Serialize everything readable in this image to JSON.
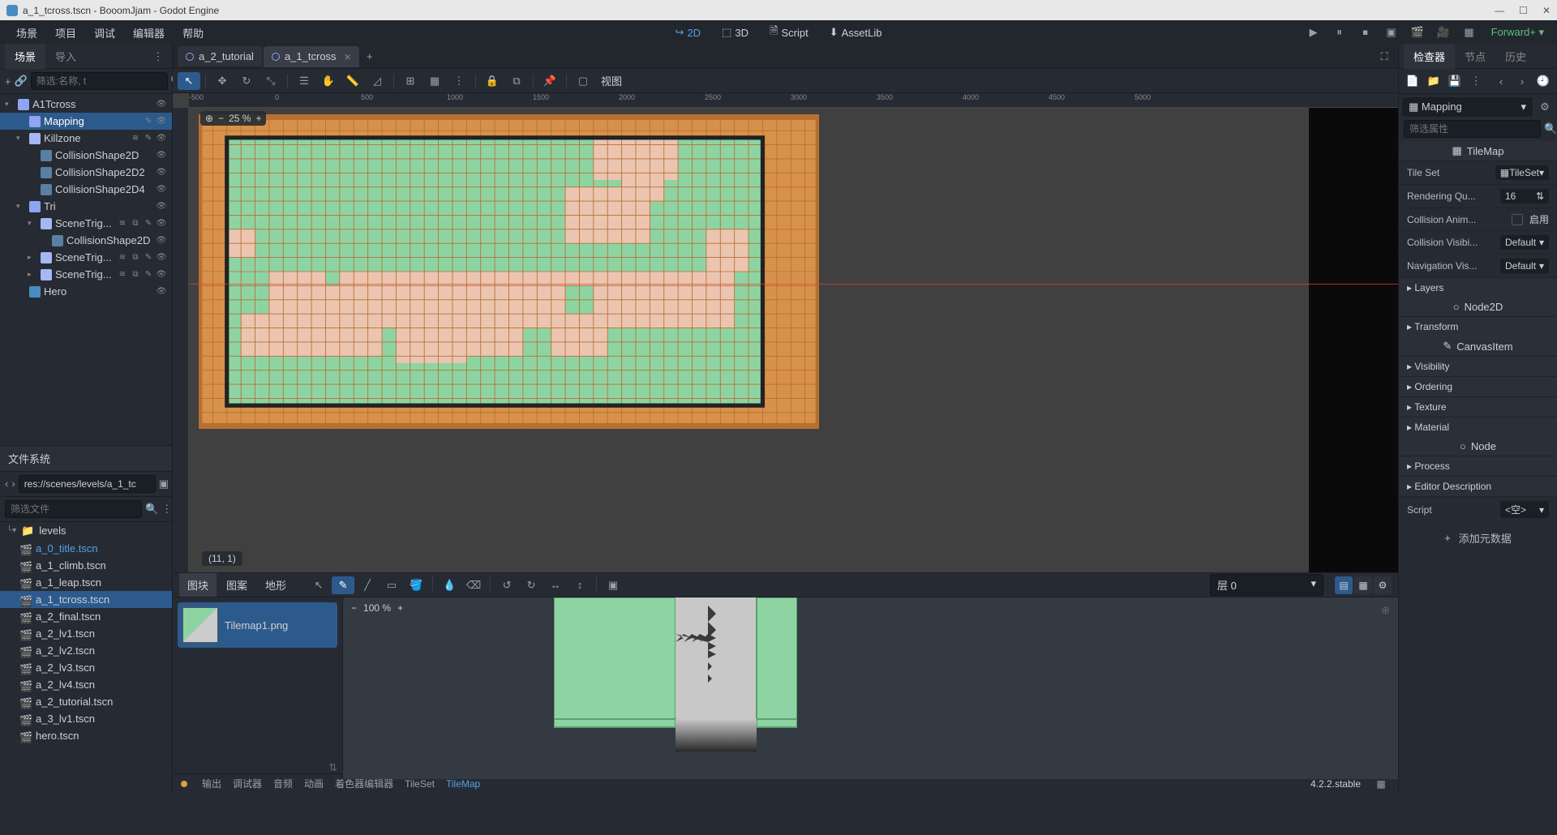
{
  "titlebar": {
    "title": "a_1_tcross.tscn - BooomJjam - Godot Engine"
  },
  "menubar": {
    "items": [
      "场景",
      "项目",
      "调试",
      "编辑器",
      "帮助"
    ],
    "center": [
      {
        "label": "2D",
        "active": true
      },
      {
        "label": "3D",
        "active": false
      },
      {
        "label": "Script",
        "active": false
      },
      {
        "label": "AssetLib",
        "active": false
      }
    ],
    "renderer": "Forward+"
  },
  "scenePanel": {
    "tabs": {
      "scene": "场景",
      "import": "导入"
    },
    "searchPlaceholder": "筛选:名称, t",
    "tree": [
      {
        "name": "A1Tcross",
        "icon": "node2d",
        "depth": 0,
        "toggle": "▾",
        "right": [
          "👁"
        ]
      },
      {
        "name": "Mapping",
        "icon": "tilemap",
        "depth": 1,
        "selected": true,
        "right": [
          "✎",
          "👁"
        ]
      },
      {
        "name": "Killzone",
        "icon": "area2d",
        "depth": 1,
        "toggle": "▾",
        "right": [
          "≋",
          "✎",
          "👁"
        ]
      },
      {
        "name": "CollisionShape2D",
        "icon": "shape2d",
        "depth": 2,
        "right": [
          "👁"
        ]
      },
      {
        "name": "CollisionShape2D2",
        "icon": "shape2d",
        "depth": 2,
        "right": [
          "👁"
        ]
      },
      {
        "name": "CollisionShape2D4",
        "icon": "shape2d",
        "depth": 2,
        "right": [
          "👁"
        ]
      },
      {
        "name": "Tri",
        "icon": "node2d",
        "depth": 1,
        "toggle": "▾",
        "right": [
          "👁"
        ]
      },
      {
        "name": "SceneTrig...",
        "icon": "area2d",
        "depth": 2,
        "toggle": "▾",
        "right": [
          "≋",
          "⧉",
          "✎",
          "👁"
        ]
      },
      {
        "name": "CollisionShape2D",
        "icon": "shape2d",
        "depth": 3,
        "right": [
          "👁"
        ]
      },
      {
        "name": "SceneTrig...",
        "icon": "area2d",
        "depth": 2,
        "toggle": "▸",
        "right": [
          "≋",
          "⧉",
          "✎",
          "👁"
        ]
      },
      {
        "name": "SceneTrig...",
        "icon": "area2d",
        "depth": 2,
        "toggle": "▸",
        "right": [
          "≋",
          "⧉",
          "✎",
          "👁"
        ]
      },
      {
        "name": "Hero",
        "icon": "animsprite",
        "depth": 1,
        "right": [
          "👁"
        ]
      }
    ]
  },
  "fileSystem": {
    "header": "文件系统",
    "path": "res://scenes/levels/a_1_tc",
    "filterPlaceholder": "筛选文件",
    "folder": "levels",
    "files": [
      {
        "name": "a_0_title.tscn",
        "link": true
      },
      {
        "name": "a_1_climb.tscn"
      },
      {
        "name": "a_1_leap.tscn"
      },
      {
        "name": "a_1_tcross.tscn",
        "selected": true
      },
      {
        "name": "a_2_final.tscn"
      },
      {
        "name": "a_2_lv1.tscn"
      },
      {
        "name": "a_2_lv2.tscn"
      },
      {
        "name": "a_2_lv3.tscn"
      },
      {
        "name": "a_2_lv4.tscn"
      },
      {
        "name": "a_2_tutorial.tscn"
      },
      {
        "name": "a_3_lv1.tscn"
      },
      {
        "name": "hero.tscn"
      }
    ]
  },
  "sceneTabs": [
    {
      "name": "a_2_tutorial",
      "active": false
    },
    {
      "name": "a_1_tcross",
      "active": true
    }
  ],
  "viewport": {
    "zoom": "25 %",
    "coord": "(11, 1)",
    "viewLabel": "视图",
    "ruler_h": [
      "-500",
      "0",
      "500",
      "1000",
      "1500",
      "2000",
      "2500",
      "3000",
      "3500",
      "4000",
      "4500",
      "5000"
    ]
  },
  "tileEditor": {
    "tabs": [
      "图块",
      "图案",
      "地形"
    ],
    "layerLabel": "层 0",
    "tilemap": "Tilemap1.png",
    "zoom": "100 %"
  },
  "status": {
    "items": [
      "输出",
      "调试器",
      "音频",
      "动画",
      "着色器编辑器",
      "TileSet",
      "TileMap"
    ],
    "active": "TileMap",
    "version": "4.2.2.stable"
  },
  "inspector": {
    "tabs": {
      "inspector": "检查器",
      "node": "节点",
      "history": "历史"
    },
    "nodeName": "Mapping",
    "filterPlaceholder": "筛选属性",
    "typeHeader": "TileMap",
    "props": [
      {
        "label": "Tile Set",
        "value": "TileSet",
        "type": "dd"
      },
      {
        "label": "Rendering Qu...",
        "value": "16",
        "type": "num"
      },
      {
        "label": "Collision Anim...",
        "checkLabel": "启用",
        "type": "cb"
      },
      {
        "label": "Collision Visibi...",
        "value": "Default",
        "type": "dd"
      },
      {
        "label": "Navigation Vis...",
        "value": "Default",
        "type": "dd"
      }
    ],
    "sections": [
      "Layers"
    ],
    "node2d": "Node2D",
    "transform": "Transform",
    "canvasItem": "CanvasItem",
    "groups": [
      "Visibility",
      "Ordering",
      "Texture",
      "Material"
    ],
    "node": "Node",
    "nodeGroups": [
      "Process",
      "Editor Description"
    ],
    "script": {
      "label": "Script",
      "value": "<空>"
    },
    "addMeta": "添加元数据"
  }
}
